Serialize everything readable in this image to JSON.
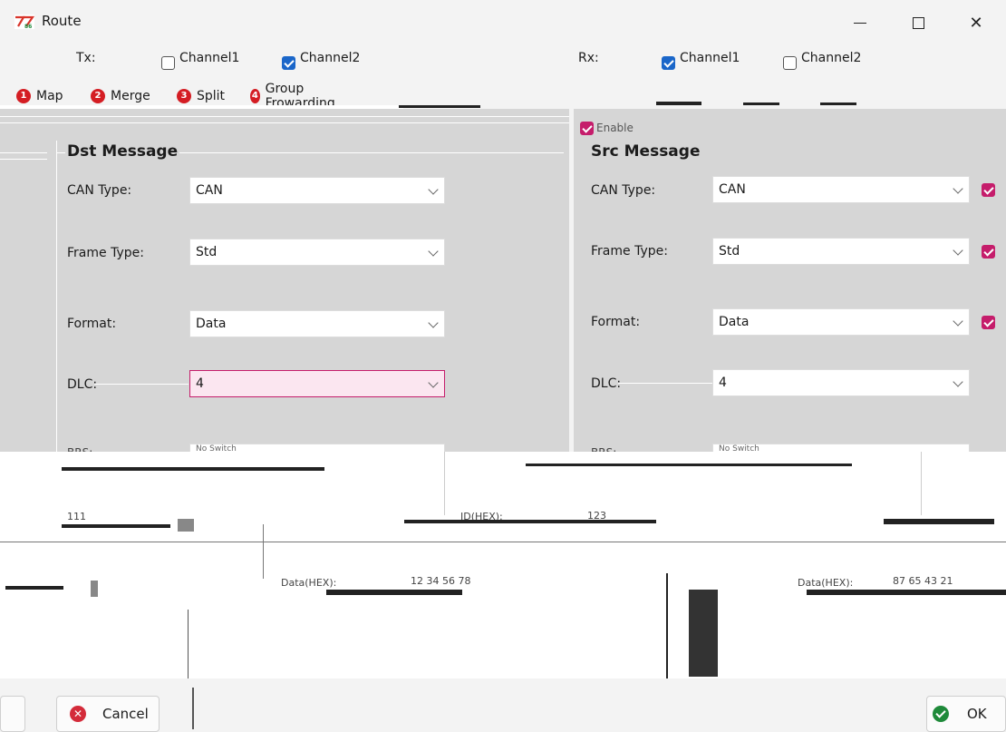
{
  "window": {
    "title": "Route"
  },
  "route": {
    "tx_label": "Tx:",
    "rx_label": "Rx:",
    "tx_channels": [
      {
        "label": "Channel1",
        "checked": false
      },
      {
        "label": "Channel2",
        "checked": true
      }
    ],
    "rx_channels": [
      {
        "label": "Channel1",
        "checked": true
      },
      {
        "label": "Channel2",
        "checked": false
      }
    ]
  },
  "tabs": [
    {
      "num": "1",
      "label": "Map"
    },
    {
      "num": "2",
      "label": "Merge"
    },
    {
      "num": "3",
      "label": "Split"
    },
    {
      "num": "4",
      "label": "Group Frowarding"
    }
  ],
  "enable_label": "Enable",
  "dst": {
    "title": "Dst Message",
    "fields": [
      {
        "label": "CAN Type:",
        "value": "CAN"
      },
      {
        "label": "Frame Type:",
        "value": "Std"
      },
      {
        "label": "Format:",
        "value": "Data"
      },
      {
        "label": "DLC:",
        "value": "4"
      },
      {
        "label": "BRS:",
        "value": "No Switch"
      }
    ]
  },
  "src": {
    "title": "Src Message",
    "fields": [
      {
        "label": "CAN Type:",
        "value": "CAN"
      },
      {
        "label": "Frame Type:",
        "value": "Std"
      },
      {
        "label": "Format:",
        "value": "Data"
      },
      {
        "label": "DLC:",
        "value": "4"
      },
      {
        "label": "BRS:",
        "value": "No Switch"
      }
    ]
  },
  "id_row": {
    "label": "ID(HEX):",
    "left_value": "111",
    "mid_value": "123"
  },
  "data_row": {
    "label": "Data(HEX):",
    "dst_value": "12 34 56 78",
    "src_value": "87 65 43 21"
  },
  "buttons": {
    "cancel": "Cancel",
    "ok": "OK"
  },
  "colors": {
    "accent": "#1a66c9",
    "pink": "#c51d6b",
    "panel": "#d6d6d6"
  }
}
